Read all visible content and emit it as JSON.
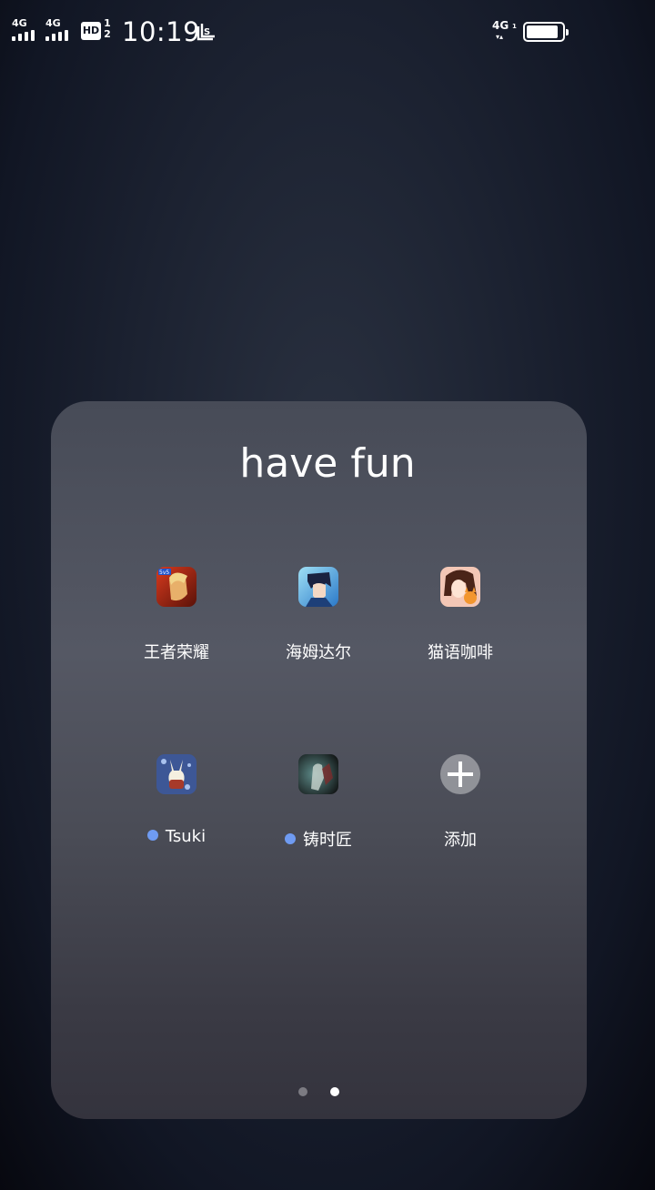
{
  "status_bar": {
    "sim1_label": "4G",
    "sim2_label": "4G",
    "hd_label": "HD",
    "hd_sub_top": "1",
    "hd_sub_bottom": "2",
    "time": "10:19",
    "network_label": "4G",
    "network_sub": "1",
    "network_arrows": "▾▴",
    "battery_level": 0.9,
    "icons": [
      "signal-icon",
      "signal-icon",
      "hd-voice-icon",
      "screenshot-icon",
      "data-activity-icon",
      "battery-icon"
    ]
  },
  "folder": {
    "title": "have fun",
    "apps": [
      {
        "label": "王者荣耀",
        "new": false,
        "icon": "honor-of-kings-icon"
      },
      {
        "label": "海姆达尔",
        "new": false,
        "icon": "heimdall-icon"
      },
      {
        "label": "猫语咖啡",
        "new": false,
        "icon": "cat-cafe-icon"
      },
      {
        "label": "Tsuki",
        "new": true,
        "icon": "tsuki-icon"
      },
      {
        "label": "铸时匠",
        "new": true,
        "icon": "clockmaker-icon"
      },
      {
        "label": "添加",
        "new": false,
        "icon": "add-icon"
      }
    ],
    "new_dot_color": "#6f9bf2",
    "pager": {
      "pages": 2,
      "current": 2
    }
  }
}
